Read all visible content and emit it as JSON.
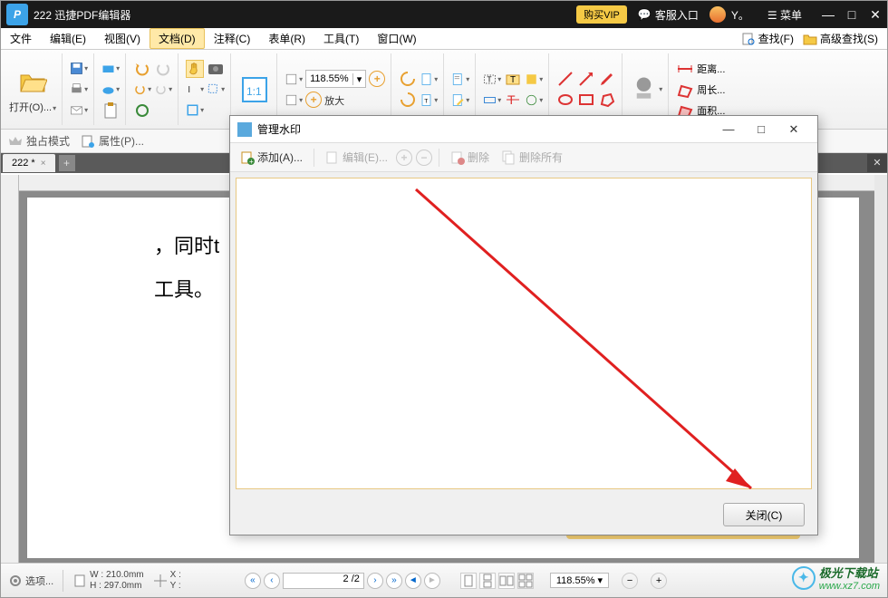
{
  "titlebar": {
    "app_title": "222 迅捷PDF编辑器",
    "vip": "购买VIP",
    "cs_icon": "💬",
    "cs": "客服入口",
    "user": "Y。",
    "menu_icon": "☰",
    "menu": "菜单",
    "min": "—",
    "max": "□",
    "close": "✕"
  },
  "menubar": {
    "file": "文件",
    "edit": "编辑(E)",
    "view": "视图(V)",
    "doc": "文档(D)",
    "annot": "注释(C)",
    "form": "表单(R)",
    "tool": "工具(T)",
    "window": "窗口(W)",
    "find": "查找(F)",
    "advfind": "高级查找(S)"
  },
  "ribbon": {
    "open": "打开(O)...",
    "zoom_val": "118.55%",
    "fit": "1:1",
    "enlarge": "放大",
    "distance": "距离...",
    "perimeter": "周长...",
    "area": "面积..."
  },
  "proprow": {
    "exclusive": "独占模式",
    "properties": "属性(P)..."
  },
  "tabs": {
    "t1": "222 *",
    "t1x": "×",
    "add": "+",
    "closeall": "✕"
  },
  "doc": {
    "line1": "，同时t",
    "line2": "工具。"
  },
  "dialog": {
    "title": "管理水印",
    "add": "添加(A)...",
    "edit": "编辑(E)...",
    "plus": "+",
    "minus": "−",
    "delete": "删除",
    "delete_all": "删除所有",
    "min": "—",
    "max": "□",
    "close_ic": "✕",
    "close_btn": "关闭(C)"
  },
  "status": {
    "options": "选项...",
    "w_lbl": "W :",
    "w": "210.0mm",
    "h_lbl": "H :",
    "h": "297.0mm",
    "x_lbl": "X :",
    "y_lbl": "Y :",
    "first": "«",
    "prev": "‹",
    "page": "2 /2",
    "next": "›",
    "last": "»",
    "zoom": "118.55%",
    "zminus": "−",
    "zplus": "+"
  },
  "watermark": {
    "site": "极光下载站",
    "url": "www.xz7.com"
  }
}
